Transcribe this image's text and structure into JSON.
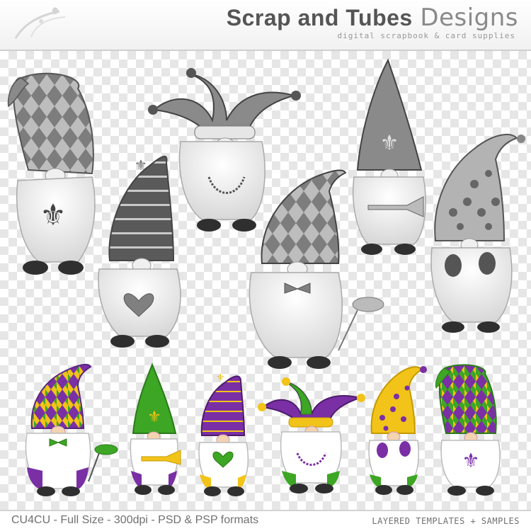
{
  "header": {
    "brand_bold": "Scrap and Tubes",
    "brand_light": "Designs",
    "tagline": "digital scrapbook & card supplies"
  },
  "footer": {
    "left_text": "CU4CU - Full Size - 300dpi - PSD & PSP formats",
    "right_text": "LAYERED TEMPLATES + SAMPLES"
  },
  "colors": {
    "purple": "#7a2fa5",
    "green": "#3da624",
    "gold": "#f2c318",
    "grey_dark": "#4a4a4a",
    "grey_mid": "#8c8c8c",
    "grey_light": "#c4c4c4"
  },
  "illustrations": {
    "template_gnomes": [
      "harlequin-gnome",
      "striped-hat-heart-gnome",
      "jester-hat-beads-gnome",
      "harlequin-bowtie-mask-gnome",
      "fleur-de-lis-trumpet-gnome",
      "polka-dot-maracas-gnome"
    ],
    "sample_gnomes": [
      "harlequin-bowtie-mask-gnome",
      "fleur-de-lis-trumpet-gnome",
      "striped-hat-heart-gnome",
      "jester-hat-beads-gnome",
      "polka-dot-maracas-gnome",
      "harlequin-fleur-de-lis-gnome"
    ]
  }
}
